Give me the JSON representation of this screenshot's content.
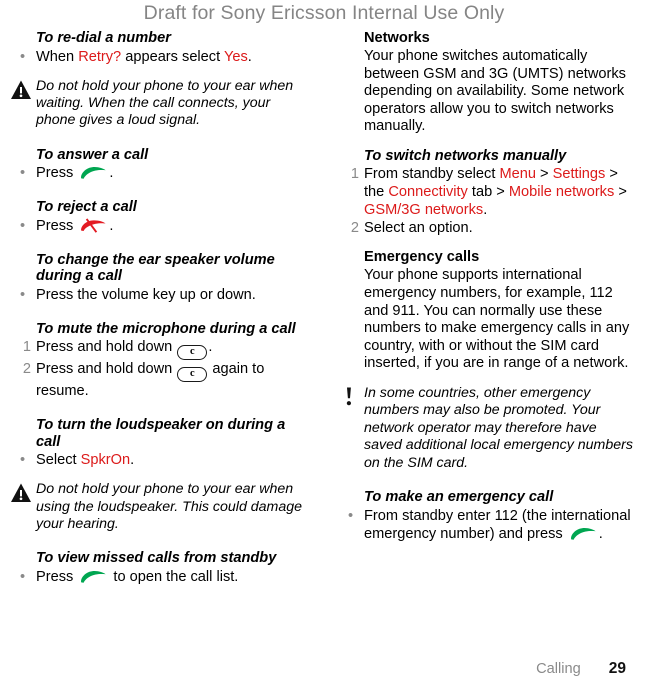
{
  "header": {
    "draft_notice": "Draft for Sony Ericsson Internal Use Only"
  },
  "colors": {
    "ui_string": "#dc1a1a",
    "draft": "#858585",
    "marker": "#8a8a8a",
    "call_icon": "#00a651",
    "end_icon": "#e31b23"
  },
  "left_column": {
    "redial": {
      "title": "To re-dial a number",
      "bullet_marker": "•",
      "text_before": "When ",
      "ui_1": "Retry?",
      "text_middle": " appears select ",
      "ui_2": "Yes",
      "text_after": "."
    },
    "warning_1": {
      "icon": "warning-triangle-icon",
      "text": "Do not hold your phone to your ear when waiting. When the call connects, your phone gives a loud signal."
    },
    "answer": {
      "title": "To answer a call",
      "bullet_marker": "•",
      "text_before": "Press ",
      "icon": "call-icon",
      "text_after": "."
    },
    "reject": {
      "title": "To reject a call",
      "bullet_marker": "•",
      "text_before": "Press ",
      "icon": "end-call-icon",
      "text_after": "."
    },
    "ear_volume": {
      "title": "To change the ear speaker volume during a call",
      "bullet_marker": "•",
      "text": "Press the volume key up or down."
    },
    "mute": {
      "title": "To mute the microphone during a call",
      "steps": [
        {
          "number": "1",
          "text_before": "Press and hold down ",
          "key": "c",
          "text_after": "."
        },
        {
          "number": "2",
          "text_before": "Press and hold down ",
          "key": "c",
          "text_after": " again to resume."
        }
      ]
    },
    "loudspeaker": {
      "title": "To turn the loudspeaker on during a call",
      "bullet_marker": "•",
      "text_before": "Select ",
      "ui_1": "SpkrOn",
      "text_after": "."
    },
    "warning_2": {
      "icon": "warning-triangle-icon",
      "text": "Do not hold your phone to your ear when using the loudspeaker. This could damage your hearing."
    },
    "missed_calls": {
      "title": "To view missed calls from standby",
      "bullet_marker": "•",
      "text_before": "Press ",
      "icon": "call-icon",
      "text_after": " to open the call list."
    }
  },
  "right_column": {
    "networks": {
      "title": "Networks",
      "body": "Your phone switches automatically between GSM and 3G (UMTS) networks depending on availability. Some network operators allow you to switch networks manually."
    },
    "switch_networks": {
      "title": "To switch networks manually",
      "steps": [
        {
          "number": "1",
          "seg_1": "From standby select ",
          "ui_1": "Menu",
          "seg_2": " > ",
          "ui_2": "Settings",
          "seg_3": " > the ",
          "ui_3": "Connectivity",
          "seg_4": " tab > ",
          "ui_4": "Mobile networks",
          "seg_5": " > ",
          "ui_5": "GSM/3G networks",
          "seg_6": "."
        },
        {
          "number": "2",
          "seg_1": "Select an option."
        }
      ]
    },
    "emergency": {
      "title": "Emergency calls",
      "body": "Your phone supports international emergency numbers, for example, 112 and 911. You can normally use these numbers to make emergency calls in any country, with or without the SIM card inserted, if you are in range of a network."
    },
    "note_1": {
      "icon": "exclamation-note-icon",
      "text": "In some countries, other emergency numbers may also be promoted. Your network operator may therefore have saved additional local emergency numbers on the SIM card."
    },
    "make_emergency": {
      "title": "To make an emergency call",
      "bullet_marker": "•",
      "text_before": "From standby enter 112 (the international emergency number) and press ",
      "icon": "call-icon",
      "text_after": "."
    }
  },
  "footer": {
    "chapter": "Calling",
    "page_number": "29"
  }
}
